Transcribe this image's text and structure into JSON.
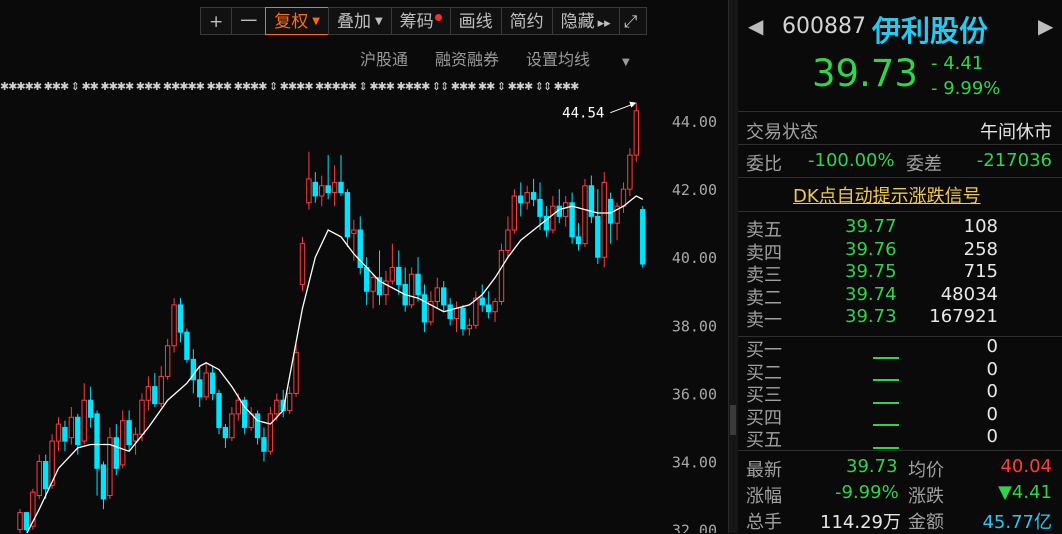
{
  "toolbar": {
    "plus": "+",
    "minus": "一",
    "fuquan": "复权",
    "diejia": "叠加",
    "chouma": "筹码",
    "huaxian": "画线",
    "jianyue": "简约",
    "yincang": "隐藏",
    "more": "▸▸",
    "expand": "⤢"
  },
  "subtoolbar": {
    "hugutong": "沪股通",
    "rongzi": "融资融券",
    "shezhi": "设置均线"
  },
  "chart_data": {
    "type": "candlestick",
    "yaxis_ticks": [
      "44.00",
      "42.00",
      "40.00",
      "38.00",
      "36.00",
      "34.00",
      "32.00"
    ],
    "ylim": [
      31.9,
      45.5
    ],
    "high_annotation": "44.54",
    "high_value": 44.54,
    "colors": {
      "up": "#ff3b3b",
      "down": "#00e5ff",
      "ma": "#ffffff"
    },
    "candles": [
      [
        32.0,
        32.6,
        31.9,
        32.5
      ],
      [
        32.5,
        32.5,
        31.95,
        32.0
      ],
      [
        32.1,
        33.2,
        32.0,
        33.1
      ],
      [
        33.0,
        34.2,
        32.9,
        34.0
      ],
      [
        34.0,
        34.2,
        32.9,
        33.2
      ],
      [
        33.3,
        34.8,
        33.2,
        34.6
      ],
      [
        34.6,
        35.3,
        34.3,
        35.1
      ],
      [
        35.0,
        35.2,
        34.3,
        34.6
      ],
      [
        34.7,
        35.6,
        34.5,
        35.3
      ],
      [
        35.3,
        35.4,
        34.2,
        34.5
      ],
      [
        34.6,
        36.3,
        34.5,
        35.8
      ],
      [
        35.8,
        36.2,
        35.0,
        35.3
      ],
      [
        35.4,
        35.5,
        33.0,
        33.8
      ],
      [
        33.9,
        34.0,
        32.6,
        32.9
      ],
      [
        33.0,
        35.0,
        32.9,
        34.7
      ],
      [
        34.7,
        35.1,
        33.6,
        33.8
      ],
      [
        33.9,
        35.5,
        33.8,
        35.2
      ],
      [
        35.2,
        35.5,
        34.3,
        34.5
      ],
      [
        34.6,
        35.0,
        34.2,
        34.8
      ],
      [
        34.8,
        36.0,
        34.6,
        35.8
      ],
      [
        35.8,
        36.5,
        35.5,
        36.2
      ],
      [
        36.2,
        36.6,
        35.6,
        35.7
      ],
      [
        35.7,
        36.8,
        35.6,
        36.5
      ],
      [
        36.5,
        37.6,
        36.4,
        37.4
      ],
      [
        37.4,
        38.8,
        37.2,
        38.6
      ],
      [
        38.6,
        38.8,
        37.5,
        37.8
      ],
      [
        37.8,
        37.9,
        36.9,
        37.0
      ],
      [
        37.0,
        37.3,
        36.0,
        36.4
      ],
      [
        36.4,
        36.8,
        35.6,
        35.9
      ],
      [
        35.9,
        36.9,
        35.8,
        36.6
      ],
      [
        36.6,
        36.8,
        35.8,
        36.0
      ],
      [
        36.0,
        36.1,
        34.8,
        35.0
      ],
      [
        35.0,
        35.1,
        34.4,
        34.7
      ],
      [
        34.7,
        35.6,
        34.6,
        35.4
      ],
      [
        35.4,
        36.0,
        35.2,
        35.8
      ],
      [
        35.8,
        35.9,
        34.8,
        35.0
      ],
      [
        35.0,
        35.6,
        34.9,
        35.4
      ],
      [
        35.4,
        35.5,
        34.5,
        34.7
      ],
      [
        34.7,
        35.0,
        34.0,
        34.3
      ],
      [
        34.3,
        35.6,
        34.2,
        35.4
      ],
      [
        35.4,
        36.0,
        35.2,
        35.8
      ],
      [
        35.8,
        36.1,
        35.3,
        35.5
      ],
      [
        35.5,
        36.2,
        35.4,
        36.0
      ],
      [
        36.0,
        37.5,
        35.9,
        37.2
      ],
      [
        39.2,
        40.6,
        39.0,
        40.4
      ],
      [
        41.6,
        43.1,
        41.4,
        42.3
      ],
      [
        42.2,
        42.5,
        41.6,
        41.8
      ],
      [
        41.8,
        42.4,
        41.5,
        42.1
      ],
      [
        42.1,
        43.0,
        41.7,
        41.9
      ],
      [
        41.9,
        42.7,
        41.5,
        42.2
      ],
      [
        42.2,
        43.0,
        41.8,
        41.9
      ],
      [
        41.9,
        42.0,
        40.3,
        40.6
      ],
      [
        40.7,
        41.1,
        39.9,
        40.8
      ],
      [
        40.8,
        41.2,
        39.5,
        39.7
      ],
      [
        39.7,
        40.0,
        38.6,
        39.0
      ],
      [
        39.0,
        39.5,
        38.5,
        39.4
      ],
      [
        39.4,
        40.2,
        38.6,
        38.9
      ],
      [
        38.9,
        39.6,
        38.6,
        39.3
      ],
      [
        39.3,
        40.4,
        39.2,
        39.7
      ],
      [
        39.7,
        40.2,
        38.9,
        39.2
      ],
      [
        39.2,
        39.7,
        38.4,
        38.6
      ],
      [
        38.6,
        39.7,
        38.5,
        39.5
      ],
      [
        39.5,
        40.0,
        38.7,
        38.9
      ],
      [
        38.9,
        39.2,
        37.8,
        38.1
      ],
      [
        38.1,
        39.0,
        38.0,
        38.7
      ],
      [
        38.7,
        39.4,
        38.5,
        39.1
      ],
      [
        39.1,
        39.3,
        38.4,
        38.6
      ],
      [
        38.6,
        38.8,
        38.0,
        38.2
      ],
      [
        38.2,
        38.7,
        37.8,
        38.5
      ],
      [
        38.5,
        38.6,
        37.7,
        37.9
      ],
      [
        37.9,
        38.2,
        37.7,
        38.0
      ],
      [
        38.0,
        39.0,
        37.9,
        38.8
      ],
      [
        38.8,
        39.2,
        38.4,
        38.6
      ],
      [
        38.6,
        39.0,
        38.2,
        38.4
      ],
      [
        38.4,
        38.8,
        38.1,
        38.7
      ],
      [
        38.7,
        40.4,
        38.6,
        40.2
      ],
      [
        40.2,
        41.2,
        40.0,
        40.8
      ],
      [
        40.8,
        42.0,
        40.7,
        41.8
      ],
      [
        41.8,
        42.2,
        41.2,
        41.6
      ],
      [
        41.6,
        42.1,
        41.4,
        41.9
      ],
      [
        41.9,
        42.3,
        41.5,
        41.7
      ],
      [
        41.7,
        42.2,
        40.8,
        41.2
      ],
      [
        41.2,
        41.5,
        40.6,
        40.8
      ],
      [
        40.8,
        41.8,
        40.7,
        41.5
      ],
      [
        41.5,
        42.0,
        41.0,
        41.2
      ],
      [
        41.2,
        41.8,
        40.9,
        41.6
      ],
      [
        41.6,
        41.9,
        40.4,
        40.6
      ],
      [
        40.6,
        41.0,
        40.2,
        40.4
      ],
      [
        40.4,
        42.3,
        40.3,
        42.1
      ],
      [
        42.1,
        42.4,
        41.0,
        41.2
      ],
      [
        41.2,
        42.0,
        39.8,
        40.0
      ],
      [
        40.0,
        42.5,
        39.7,
        42.2
      ],
      [
        41.7,
        41.9,
        40.4,
        41.0
      ],
      [
        41.0,
        41.6,
        40.5,
        41.5
      ],
      [
        41.5,
        42.2,
        41.3,
        42.0
      ],
      [
        42.0,
        43.2,
        41.8,
        43.0
      ],
      [
        43.0,
        44.54,
        42.8,
        44.3
      ],
      [
        41.4,
        41.5,
        39.7,
        39.8
      ]
    ],
    "ma": [
      [
        0,
        31.5
      ],
      [
        3,
        32.6
      ],
      [
        6,
        33.8
      ],
      [
        9,
        34.4
      ],
      [
        11,
        34.5
      ],
      [
        14,
        34.5
      ],
      [
        17,
        34.3
      ],
      [
        20,
        35.0
      ],
      [
        23,
        35.8
      ],
      [
        26,
        36.3
      ],
      [
        28,
        36.8
      ],
      [
        29,
        36.9
      ],
      [
        31,
        36.7
      ],
      [
        33,
        36.2
      ],
      [
        35,
        35.6
      ],
      [
        37,
        35.2
      ],
      [
        39,
        35.1
      ],
      [
        41,
        35.5
      ],
      [
        42,
        36.5
      ],
      [
        44,
        38.5
      ],
      [
        46,
        40.0
      ],
      [
        48,
        40.8
      ],
      [
        50,
        40.6
      ],
      [
        52,
        40.1
      ],
      [
        54,
        39.7
      ],
      [
        56,
        39.3
      ],
      [
        58,
        39.1
      ],
      [
        60,
        38.9
      ],
      [
        62,
        38.8
      ],
      [
        64,
        38.6
      ],
      [
        66,
        38.4
      ],
      [
        68,
        38.5
      ],
      [
        70,
        38.6
      ],
      [
        72,
        38.9
      ],
      [
        74,
        39.4
      ],
      [
        76,
        40.0
      ],
      [
        78,
        40.5
      ],
      [
        80,
        40.8
      ],
      [
        82,
        41.1
      ],
      [
        84,
        41.4
      ],
      [
        86,
        41.5
      ],
      [
        88,
        41.4
      ],
      [
        90,
        41.3
      ],
      [
        92,
        41.3
      ],
      [
        94,
        41.5
      ],
      [
        96,
        41.8
      ],
      [
        97,
        41.7
      ]
    ]
  },
  "stock": {
    "code": "600887",
    "name": "伊利股份",
    "price": "39.73",
    "change": "- 4.41",
    "change_pct": "- 9.99%",
    "nav_left": "◀",
    "nav_right": "◀"
  },
  "status": {
    "label": "交易状态",
    "value": "午间休市",
    "weibi_label": "委比",
    "weibi_value": "-100.00%",
    "weicha_label": "委差",
    "weicha_value": "-217036"
  },
  "dk_signal": "DK点自动提示涨跌信号",
  "asks": [
    {
      "label": "卖五",
      "price": "39.77",
      "vol": "108"
    },
    {
      "label": "卖四",
      "price": "39.76",
      "vol": "258"
    },
    {
      "label": "卖三",
      "price": "39.75",
      "vol": "715"
    },
    {
      "label": "卖二",
      "price": "39.74",
      "vol": "48034"
    },
    {
      "label": "卖一",
      "price": "39.73",
      "vol": "167921"
    }
  ],
  "bids": [
    {
      "label": "买一",
      "vol": "0"
    },
    {
      "label": "买二",
      "vol": "0"
    },
    {
      "label": "买三",
      "vol": "0"
    },
    {
      "label": "买四",
      "vol": "0"
    },
    {
      "label": "买五",
      "vol": "0"
    }
  ],
  "stats": {
    "latest_label": "最新",
    "latest": "39.73",
    "avg_label": "均价",
    "avg": "40.04",
    "pct_label": "涨幅",
    "pct": "-9.99%",
    "chg_label": "涨跌",
    "chg": "▼4.41",
    "vol_label": "总手",
    "vol": "114.29万",
    "amt_label": "金额",
    "amt": "45.77亿"
  },
  "signal_markers": "✱✱✱✱✱ ✱✱✱ ⇕ ✱✱ ✱✱✱✱ ✱✱✱ ✱✱✱✱✱ ✱✱✱ ✱✱✱✱ ⇕ ✱✱✱✱ ✱✱✱✱✱ ⇕ ✱✱✱ ✱✱✱✱ ⇕⇕ ✱✱✱ ✱✱ ⇕ ✱✱✱ ⇕⇕ ✱✱✱"
}
